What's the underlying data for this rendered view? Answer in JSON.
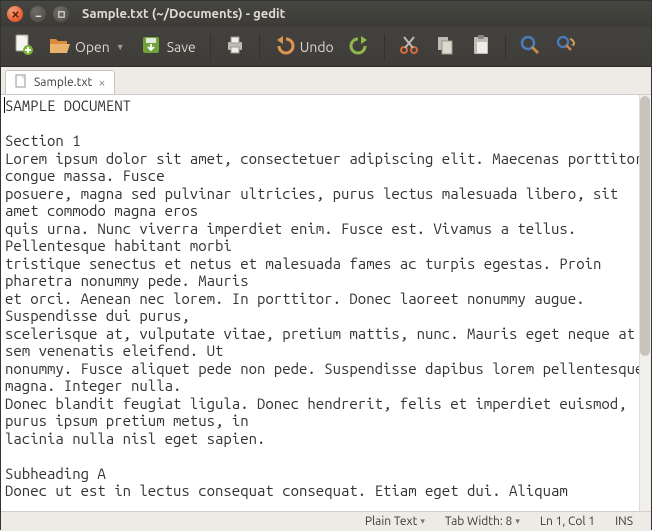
{
  "window": {
    "title": "Sample.txt (~/Documents) - gedit"
  },
  "toolbar": {
    "open_label": "Open",
    "save_label": "Save",
    "undo_label": "Undo"
  },
  "tabs": [
    {
      "label": "Sample.txt"
    }
  ],
  "document": {
    "text": "SAMPLE DOCUMENT\n\nSection 1\nLorem ipsum dolor sit amet, consectetuer adipiscing elit. Maecenas porttitor congue massa. Fusce\nposuere, magna sed pulvinar ultricies, purus lectus malesuada libero, sit amet commodo magna eros\nquis urna. Nunc viverra imperdiet enim. Fusce est. Vivamus a tellus. Pellentesque habitant morbi\ntristique senectus et netus et malesuada fames ac turpis egestas. Proin pharetra nonummy pede. Mauris\net orci. Aenean nec lorem. In porttitor. Donec laoreet nonummy augue. Suspendisse dui purus,\nscelerisque at, vulputate vitae, pretium mattis, nunc. Mauris eget neque at sem venenatis eleifend. Ut\nnonummy. Fusce aliquet pede non pede. Suspendisse dapibus lorem pellentesque magna. Integer nulla.\nDonec blandit feugiat ligula. Donec hendrerit, felis et imperdiet euismod, purus ipsum pretium metus, in\nlacinia nulla nisl eget sapien.\n\nSubheading A\nDonec ut est in lectus consequat consequat. Etiam eget dui. Aliquam"
  },
  "statusbar": {
    "syntax": "Plain Text",
    "tabwidth": "Tab Width: 8",
    "position": "Ln 1, Col 1",
    "insert_mode": "INS"
  }
}
